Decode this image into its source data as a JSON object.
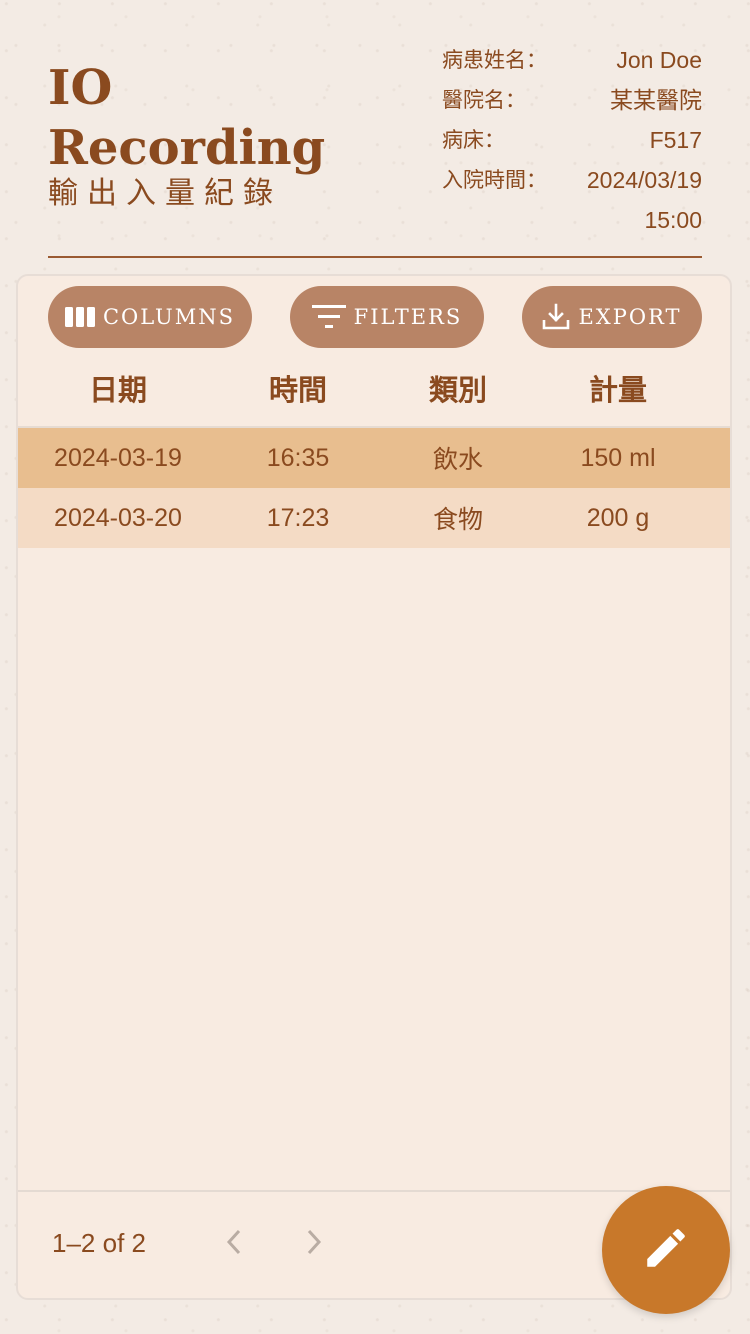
{
  "header": {
    "title_line1": "IO",
    "title_line2": "Recording",
    "subtitle": "輸出入量紀錄"
  },
  "patient": {
    "name_label": "病患姓名：",
    "name_value": "Jon Doe",
    "hospital_label": "醫院名：",
    "hospital_value": "某某醫院",
    "bed_label": "病床：",
    "bed_value": "F517",
    "admit_label": "入院時間：",
    "admit_value": "2024/03/19 15:00"
  },
  "toolbar": {
    "columns_label": "COLUMNS",
    "filters_label": "FILTERS",
    "export_label": "EXPORT",
    "icons": [
      "columns-icon",
      "filter-icon",
      "download-icon"
    ]
  },
  "table": {
    "columns": [
      "日期",
      "時間",
      "類別",
      "計量"
    ],
    "rows": [
      [
        "2024-03-19",
        "16:35",
        "飲水",
        "150 ml"
      ],
      [
        "2024-03-20",
        "17:23",
        "食物",
        "200 g"
      ]
    ],
    "selected_row": 0
  },
  "pagination": {
    "range_text": "1–2 of 2",
    "icons": [
      "chevron-left-icon",
      "chevron-right-icon"
    ]
  },
  "fab": {
    "icon": "pencil-icon"
  },
  "colors": {
    "text_brown": "#8a4a1f",
    "button_bg": "#b88466",
    "selected_row": "#e8be8f",
    "row_bg": "#f4dbc5",
    "card_bg": "#f8ebe1",
    "fab_bg": "#c8782a"
  }
}
